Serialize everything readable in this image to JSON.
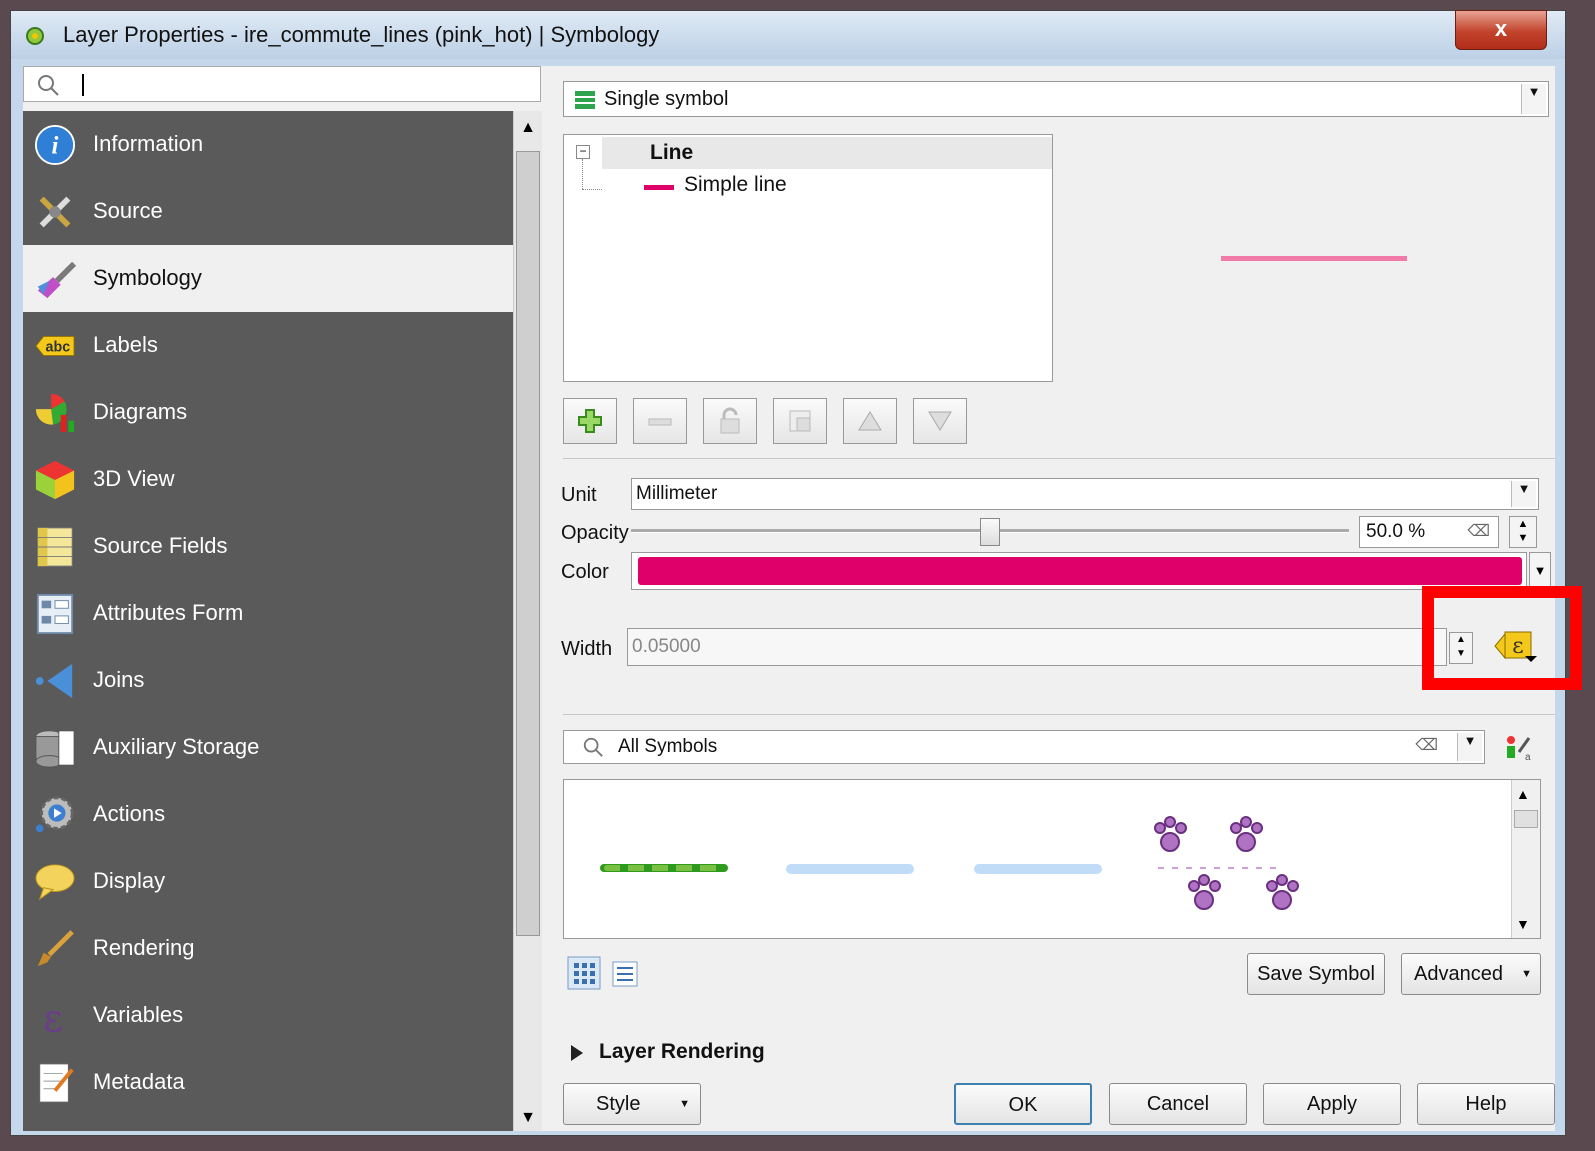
{
  "window": {
    "title": "Layer Properties - ire_commute_lines (pink_hot) | Symbology",
    "close_label": "x"
  },
  "search": {
    "value": ""
  },
  "nav": {
    "items": [
      {
        "label": "Information",
        "icon": "info-icon"
      },
      {
        "label": "Source",
        "icon": "tools-icon"
      },
      {
        "label": "Symbology",
        "icon": "paintbrush-icon",
        "active": true
      },
      {
        "label": "Labels",
        "icon": "abc-label-icon"
      },
      {
        "label": "Diagrams",
        "icon": "diagram-icon"
      },
      {
        "label": "3D View",
        "icon": "cube-icon"
      },
      {
        "label": "Source Fields",
        "icon": "fields-icon"
      },
      {
        "label": "Attributes Form",
        "icon": "form-icon"
      },
      {
        "label": "Joins",
        "icon": "joins-icon"
      },
      {
        "label": "Auxiliary Storage",
        "icon": "database-icon"
      },
      {
        "label": "Actions",
        "icon": "gear-icon"
      },
      {
        "label": "Display",
        "icon": "speech-bubble-icon"
      },
      {
        "label": "Rendering",
        "icon": "brush-icon"
      },
      {
        "label": "Variables",
        "icon": "epsilon-icon"
      },
      {
        "label": "Metadata",
        "icon": "document-icon"
      }
    ]
  },
  "renderer": {
    "selected": "Single symbol"
  },
  "symbol_tree": {
    "root": "Line",
    "child": "Simple line"
  },
  "properties": {
    "unit_label": "Unit",
    "unit_value": "Millimeter",
    "opacity_label": "Opacity",
    "opacity_value": "50.0 %",
    "opacity_fraction": 0.5,
    "color_label": "Color",
    "color_value": "#e0006a",
    "width_label": "Width",
    "width_value": "0.05000"
  },
  "library": {
    "filter_value": "All Symbols",
    "save_symbol": "Save Symbol",
    "advanced": "Advanced"
  },
  "layer_rendering": {
    "label": "Layer Rendering"
  },
  "footer": {
    "style": "Style",
    "ok": "OK",
    "cancel": "Cancel",
    "apply": "Apply",
    "help": "Help"
  },
  "colors": {
    "accent_pink": "#e0006a",
    "preview_pink": "#f07aa8",
    "highlight": "#ff0000",
    "nav_bg": "#5a5a5a"
  }
}
